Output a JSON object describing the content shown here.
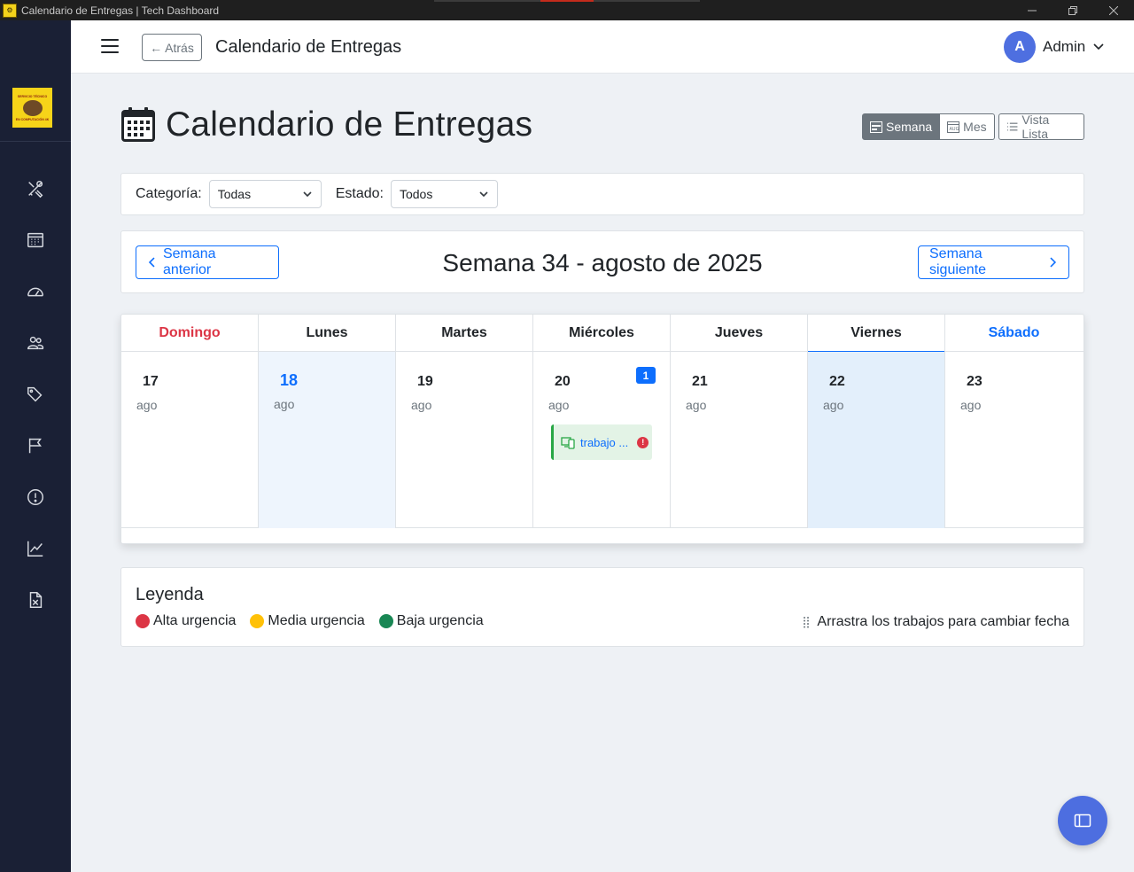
{
  "window": {
    "title": "Calendario de Entregas | Tech Dashboard",
    "controls": [
      "minimize-icon",
      "restore-icon",
      "close-icon"
    ]
  },
  "sidebar": {
    "logo_text": "SERVICIO TÉCNICO EN COMPUTACIÓN 4K",
    "items": [
      {
        "icon": "tools-icon"
      },
      {
        "icon": "calendar-grid-icon"
      },
      {
        "icon": "speedometer-icon"
      },
      {
        "icon": "people-icon"
      },
      {
        "icon": "tags-icon"
      },
      {
        "icon": "flag-icon"
      },
      {
        "icon": "exclamation-circle-icon"
      },
      {
        "icon": "graph-icon"
      },
      {
        "icon": "file-excel-icon"
      }
    ]
  },
  "header": {
    "back_label": "Atrás",
    "title": "Calendario de Entregas",
    "avatar_initial": "A",
    "user_name": "Admin"
  },
  "page": {
    "title": "Calendario de Entregas",
    "views": {
      "week": "Semana",
      "month": "Mes",
      "list": "Vista Lista"
    },
    "active_view": "week"
  },
  "filters": {
    "category_label": "Categoría:",
    "category_value": "Todas",
    "status_label": "Estado:",
    "status_value": "Todos"
  },
  "week_nav": {
    "prev_label": "Semana anterior",
    "title": "Semana 34 - agosto de 2025",
    "next_label": "Semana siguiente"
  },
  "calendar": {
    "days": [
      {
        "name": "Domingo",
        "num": "17",
        "month": "ago"
      },
      {
        "name": "Lunes",
        "num": "18",
        "month": "ago"
      },
      {
        "name": "Martes",
        "num": "19",
        "month": "ago"
      },
      {
        "name": "Miércoles",
        "num": "20",
        "month": "ago",
        "count": "1",
        "event": "trabajo ..."
      },
      {
        "name": "Jueves",
        "num": "21",
        "month": "ago"
      },
      {
        "name": "Viernes",
        "num": "22",
        "month": "ago"
      },
      {
        "name": "Sábado",
        "num": "23",
        "month": "ago"
      }
    ],
    "today_index": 5,
    "selected_index": 1
  },
  "legend": {
    "title": "Leyenda",
    "items": [
      {
        "label": "Alta urgencia",
        "color": "#dc3545"
      },
      {
        "label": "Media urgencia",
        "color": "#ffc107"
      },
      {
        "label": "Baja urgencia",
        "color": "#198754"
      }
    ],
    "hint": "Arrastra los trabajos para cambiar fecha"
  },
  "colors": {
    "accent": "#0d6efd",
    "sidebar_bg": "#1a2035",
    "fab": "#4d6ee0"
  }
}
